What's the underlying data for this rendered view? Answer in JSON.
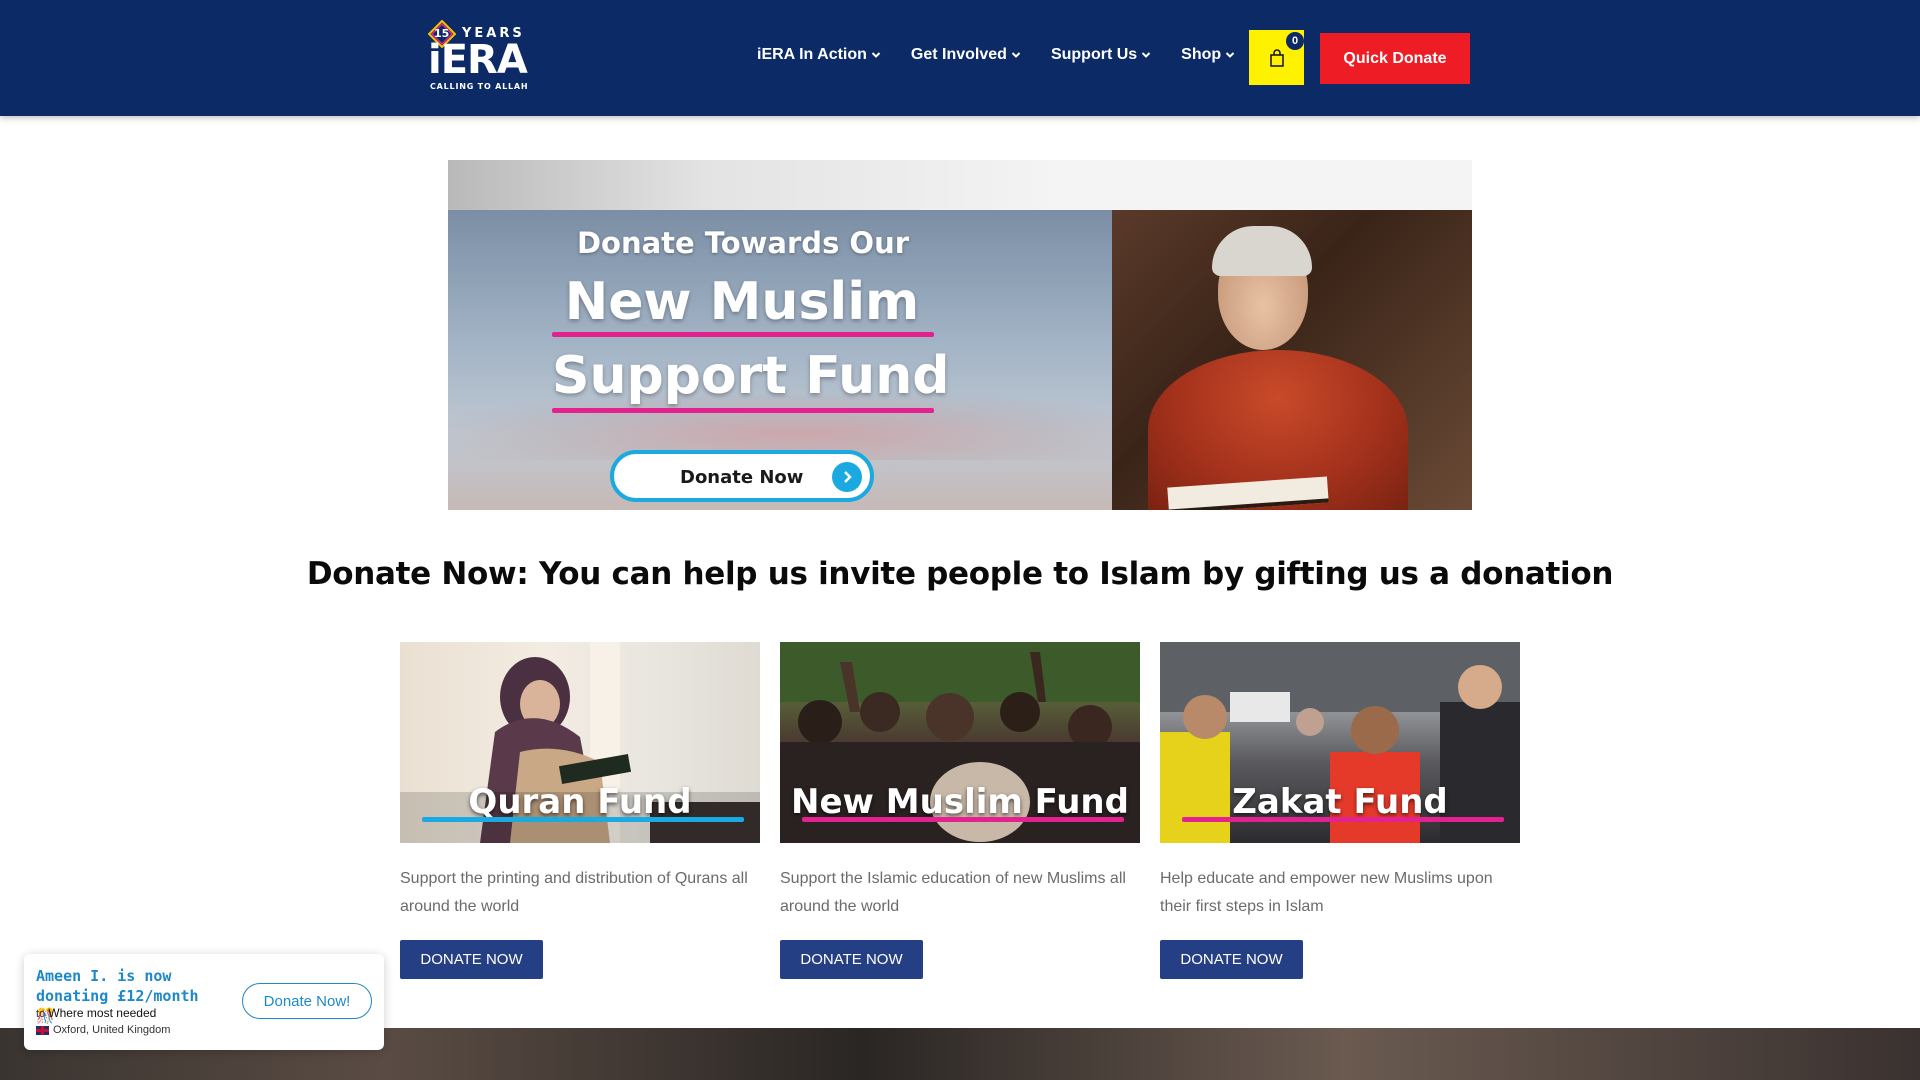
{
  "header": {
    "logo": {
      "badge": "15",
      "years": "YEARS",
      "wordmark": "iERA",
      "tagline": "CALLING TO ALLAH"
    },
    "nav": [
      {
        "label": "iERA In Action"
      },
      {
        "label": "Get Involved"
      },
      {
        "label": "Support Us"
      },
      {
        "label": "Shop"
      }
    ],
    "cart": {
      "count": "0",
      "icon": "shopping-bag-icon"
    },
    "quick_donate_label": "Quick Donate",
    "colors": {
      "background": "#0b2a66",
      "cart": "#fff200",
      "quick_donate": "#ee1c25"
    }
  },
  "hero": {
    "line1": "Donate Towards Our",
    "line2": "New Muslim",
    "line3": "Support Fund",
    "button_label": "Donate Now",
    "accent": "#e3218f",
    "button_accent": "#1aa9e0"
  },
  "section": {
    "title": "Donate Now: You can help us invite people to Islam by gifting us a donation"
  },
  "cards": [
    {
      "title": "Quran Fund",
      "bar_color": "#1aa9e0",
      "description": "Support the printing and distribution of Qurans all around the world",
      "button_label": "DONATE NOW"
    },
    {
      "title": "New Muslim Fund",
      "bar_color": "#e3218f",
      "description": "Support the Islamic education of new Muslims all around the world",
      "button_label": "DONATE NOW"
    },
    {
      "title": "Zakat Fund",
      "bar_color": "#e3218f",
      "description": "Help educate and empower new Muslims upon their first steps in Islam",
      "button_label": "DONATE NOW"
    }
  ],
  "popup": {
    "line1": "Ameen I. is now donating £12/month",
    "emoji": "🎊",
    "to_prefix": "to",
    "to_target": "Where most needed",
    "location": "Oxford, United Kingdom",
    "button_label": "Donate Now!"
  }
}
